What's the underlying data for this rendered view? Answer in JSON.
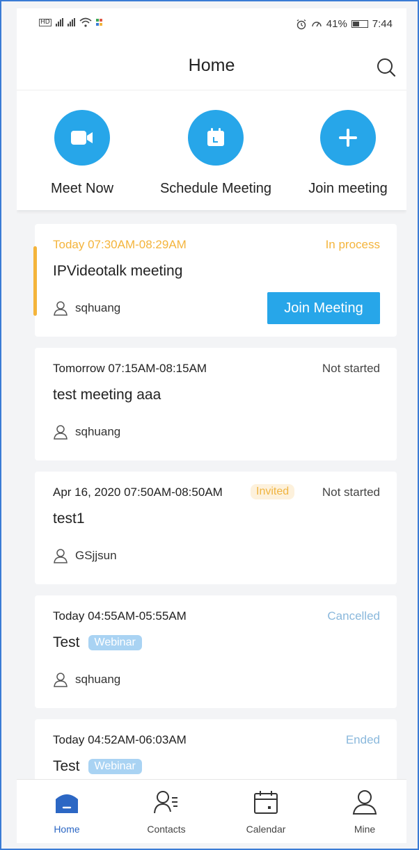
{
  "status_bar": {
    "battery": "41%",
    "time": "7:44"
  },
  "header": {
    "title": "Home"
  },
  "quick_actions": [
    {
      "label": "Meet Now",
      "icon": "video-camera-icon"
    },
    {
      "label": "Schedule Meeting",
      "icon": "calendar-icon"
    },
    {
      "label": "Join meeting",
      "icon": "plus-icon"
    }
  ],
  "meetings": [
    {
      "time": "Today 07:30AM-08:29AM",
      "status": "In process",
      "title": "IPVideotalk meeting",
      "host": "sqhuang",
      "action": "Join Meeting"
    },
    {
      "time": "Tomorrow 07:15AM-08:15AM",
      "status": "Not started",
      "title": "test meeting aaa",
      "host": "sqhuang"
    },
    {
      "time": "Apr 16, 2020 07:50AM-08:50AM",
      "tag": "Invited",
      "status": "Not started",
      "title": "test1",
      "host": "GSjjsun"
    },
    {
      "time": "Today 04:55AM-05:55AM",
      "status": "Cancelled",
      "title": "Test",
      "tag": "Webinar",
      "host": "sqhuang"
    },
    {
      "time": "Today 04:52AM-06:03AM",
      "status": "Ended",
      "title": "Test",
      "tag": "Webinar"
    }
  ],
  "colors": {
    "accent": "#27a6e9",
    "in_process": "#f4b43b",
    "cancelled": "#8ab8dc",
    "ended": "#8ab8dc",
    "nav_active": "#2c67c4"
  },
  "bottom_nav": [
    {
      "label": "Home",
      "icon": "home-icon"
    },
    {
      "label": "Contacts",
      "icon": "contacts-icon"
    },
    {
      "label": "Calendar",
      "icon": "calendar-icon"
    },
    {
      "label": "Mine",
      "icon": "user-icon"
    }
  ]
}
